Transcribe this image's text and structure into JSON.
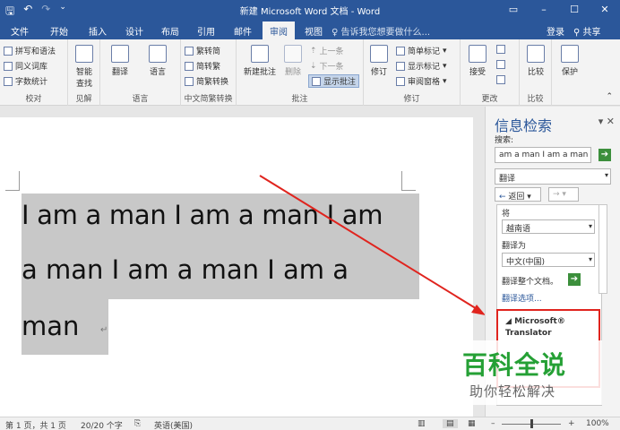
{
  "titlebar": {
    "title": "新建 Microsoft Word 文档 - Word",
    "qat": [
      "save-icon",
      "undo-icon",
      "redo-icon",
      "customize-icon"
    ],
    "window_buttons": [
      "ribbon-display-icon",
      "minimize-icon",
      "maximize-icon",
      "close-icon"
    ]
  },
  "tabs": [
    "文件",
    "开始",
    "插入",
    "设计",
    "布局",
    "引用",
    "邮件",
    "审阅",
    "视图"
  ],
  "active_tab": "审阅",
  "tell_me": "告诉我您想要做什么...",
  "login": "登录",
  "share": "共享",
  "ribbon": {
    "proofing": {
      "label": "校对",
      "items": [
        "拼写和语法",
        "同义词库",
        "字数统计"
      ]
    },
    "insights": {
      "label": "见解",
      "button": "智能\n查找"
    },
    "language": {
      "label": "语言",
      "translate": "翻译",
      "language": "语言"
    },
    "chinese_conv": {
      "label": "中文简繁转换",
      "items": [
        "繁转简",
        "简转繁",
        "简繁转换"
      ]
    },
    "comments": {
      "label": "批注",
      "new": "新建批注",
      "delete": "删除",
      "prev": "上一条",
      "next": "下一条",
      "show": "显示批注"
    },
    "tracking": {
      "label": "修订",
      "track": "修订",
      "markup": "简单标记",
      "show_markup": "显示标记",
      "pane": "审阅窗格"
    },
    "changes": {
      "label": "更改",
      "accept": "接受"
    },
    "compare": {
      "label": "比较",
      "compare": "比较"
    },
    "protect": {
      "label": "",
      "protect": "保护"
    }
  },
  "document": {
    "lines": [
      "I am a man I am a man I am",
      "a  man  I  am  a  man  I  am  a",
      "man"
    ],
    "paragraph_mark": "↵"
  },
  "pane": {
    "title": "信息检索",
    "search_label": "搜索:",
    "search_value": "am a man I am a man",
    "service": "翻译",
    "back": "返回",
    "from_label": "将",
    "from_value": "越南语",
    "to_label": "翻译为",
    "to_value": "中文(中国)",
    "translate_doc": "翻译整个文档。",
    "options": "翻译选项...",
    "result_title": "Microsoft® Translator"
  },
  "statusbar": {
    "page": "第 1 页，共 1 页",
    "words": "20/20 个字",
    "language": "英语(美国)",
    "zoom": "100%"
  },
  "watermark": {
    "title": "百科全说",
    "subtitle": "助你轻松解决"
  },
  "colors": {
    "brand": "#2b579a",
    "selection": "#c8c8c8",
    "annotation_red": "#e0241e",
    "watermark_green": "#25a035"
  }
}
